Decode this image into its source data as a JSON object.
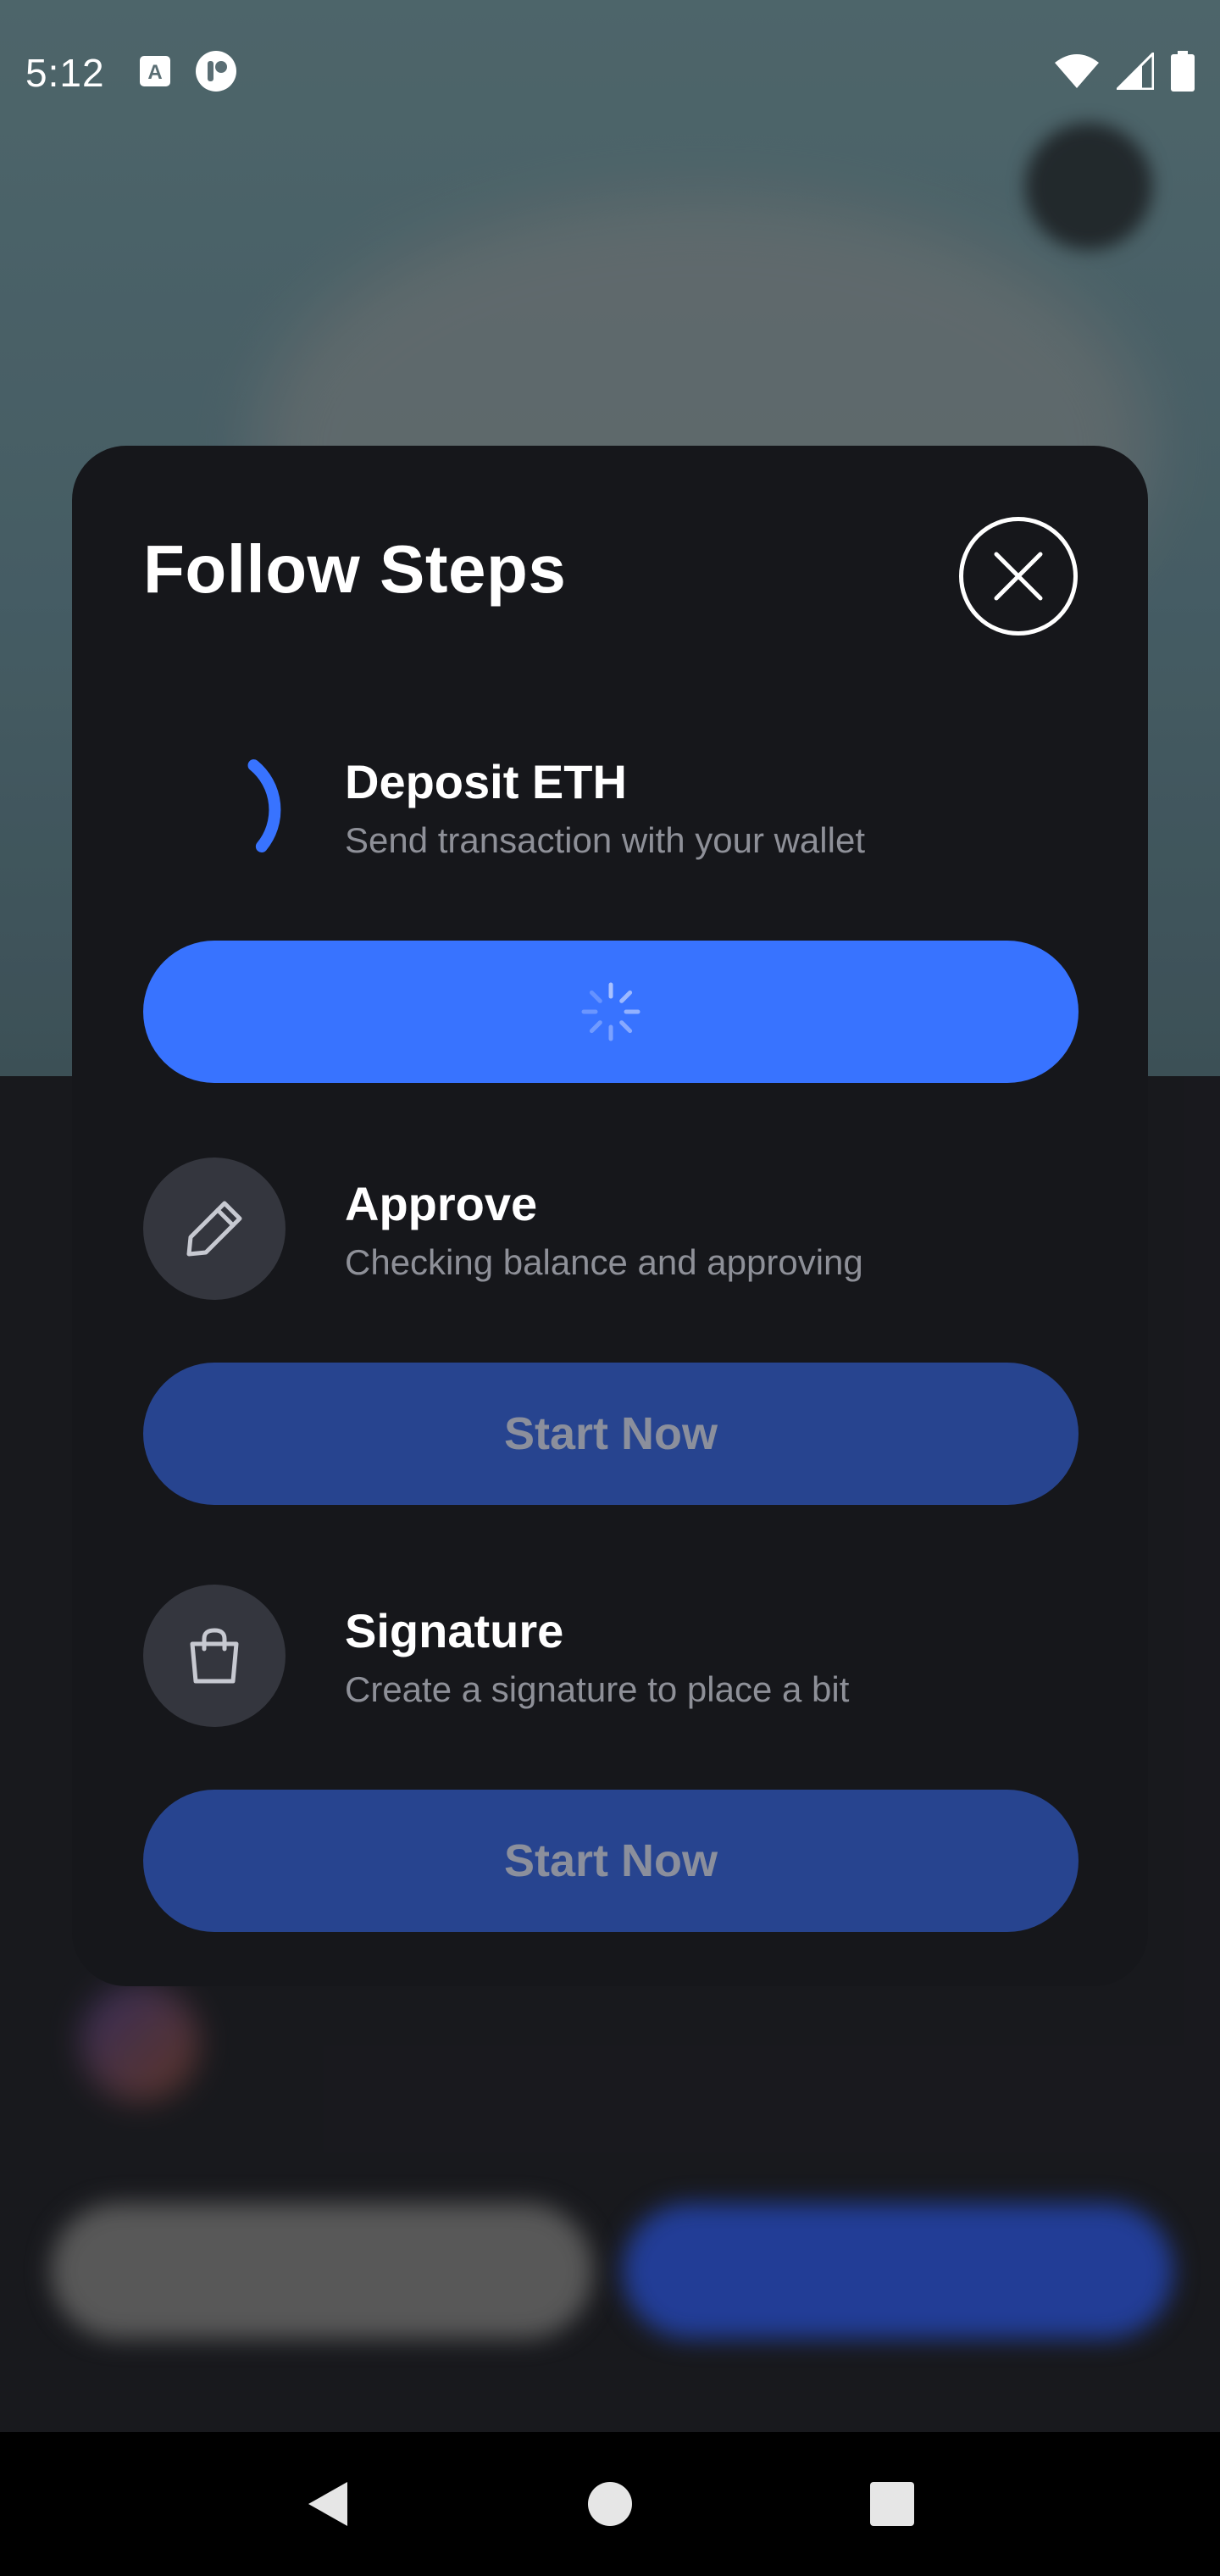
{
  "status_bar": {
    "time": "5:12",
    "left_icons": [
      "text-input-icon",
      "app-notification-icon"
    ],
    "right_icons": [
      "wifi-icon",
      "cellular-signal-icon",
      "battery-icon"
    ]
  },
  "modal": {
    "title": "Follow Steps",
    "close_icon": "close-icon",
    "steps": [
      {
        "title": "Deposit ETH",
        "subtitle": "Send transaction with your wallet",
        "icon": "progress-ring-icon",
        "state": "loading",
        "button_label": "",
        "button_icon": "spinner-icon"
      },
      {
        "title": "Approve",
        "subtitle": "Checking balance and approving",
        "icon": "pencil-icon",
        "state": "disabled",
        "button_label": "Start Now"
      },
      {
        "title": "Signature",
        "subtitle": "Create a signature to place a bit",
        "icon": "shopping-bag-icon",
        "state": "disabled",
        "button_label": "Start Now"
      }
    ]
  },
  "nav_bar": {
    "buttons": [
      "back-icon",
      "home-icon",
      "recents-icon"
    ]
  },
  "colors": {
    "accent": "#3873ff",
    "button_disabled": "#27448f",
    "modal_bg": "#16171b",
    "icon_circle": "#34363e",
    "subtitle_text": "#8e9098"
  }
}
